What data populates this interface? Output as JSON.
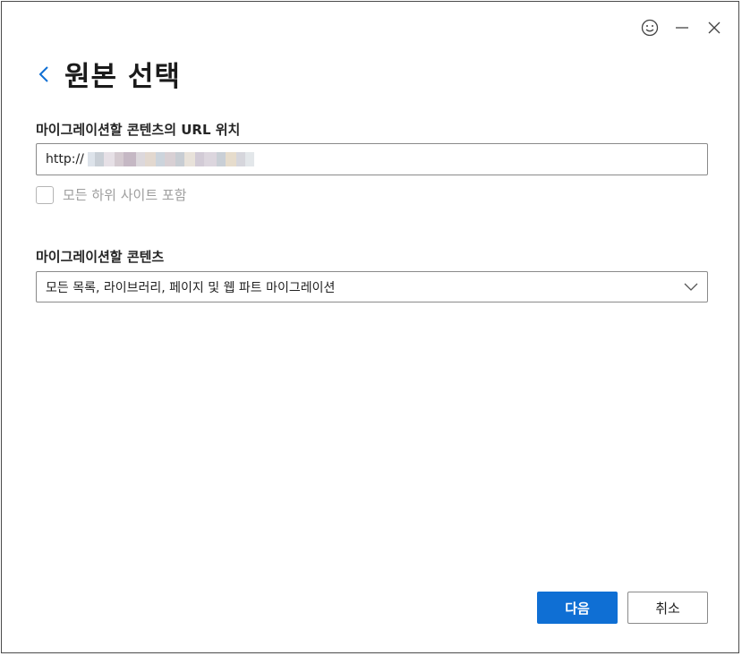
{
  "dialog": {
    "title": "원본 선택"
  },
  "url_section": {
    "label": "마이그레이션할 콘텐츠의 URL 위치",
    "url_prefix": "http://",
    "checkbox_label": "모든 하위 사이트 포함",
    "checkbox_checked": false
  },
  "content_section": {
    "label": "마이그레이션할 콘텐츠",
    "selected_option": "모든 목록, 라이브러리, 페이지 및 웹 파트 마이그레이션"
  },
  "buttons": {
    "next_label": "다음",
    "cancel_label": "취소"
  },
  "icons": {
    "feedback": "smiley-icon",
    "minimize": "minimize-icon",
    "close": "close-icon",
    "back": "chevron-left-icon",
    "dropdown": "chevron-down-icon"
  },
  "colors": {
    "accent": "#0f6fd4",
    "back_arrow": "#0f6fd4"
  }
}
